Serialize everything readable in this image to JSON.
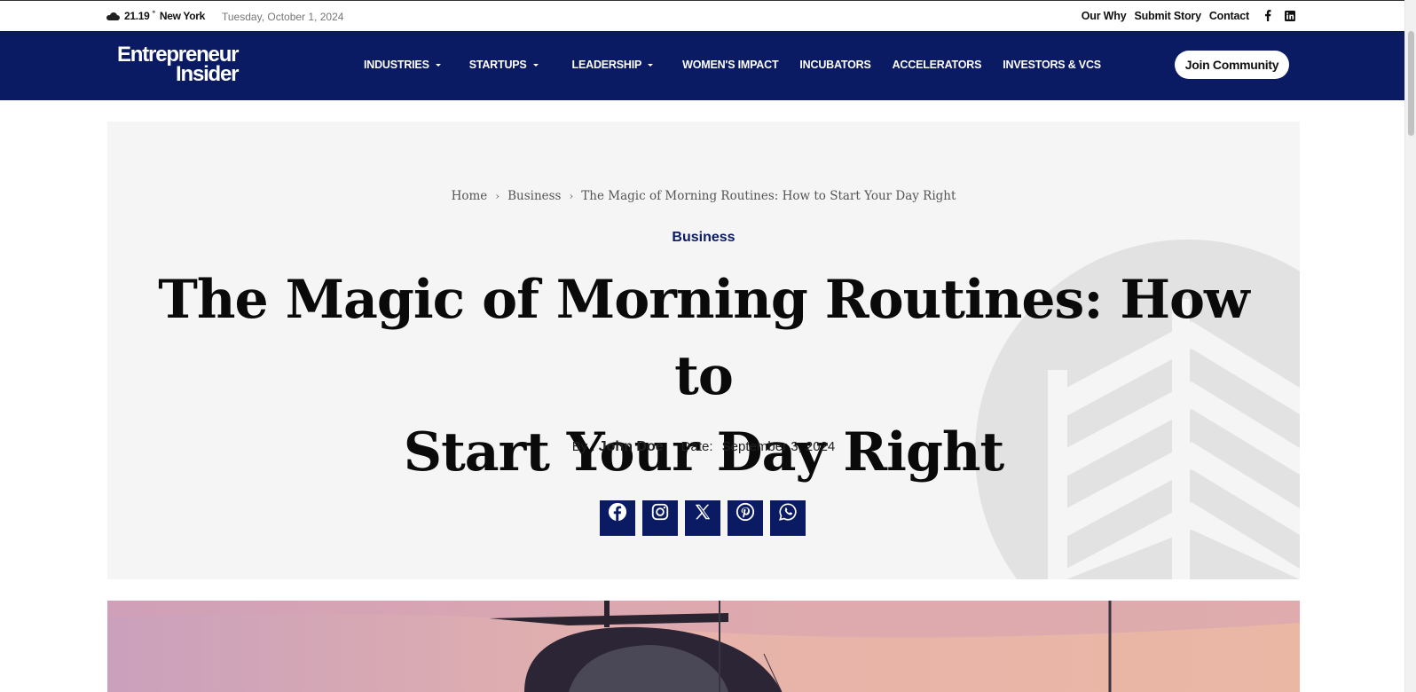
{
  "topbar": {
    "temperature": "21.19",
    "unit": "°",
    "city": "New York",
    "date": "Tuesday, October 1, 2024",
    "links": [
      "Our Why",
      "Submit Story",
      "Contact"
    ]
  },
  "nav": {
    "logo_line1": "Entrepreneur",
    "logo_line2": "Insider",
    "menu": [
      {
        "label": "INDUSTRIES",
        "dropdown": true
      },
      {
        "label": "STARTUPS",
        "dropdown": true
      },
      {
        "label": "LEADERSHIP",
        "dropdown": true
      },
      {
        "label": "WOMEN'S IMPACT",
        "dropdown": false
      },
      {
        "label": "INCUBATORS",
        "dropdown": false
      },
      {
        "label": "ACCELERATORS",
        "dropdown": false
      },
      {
        "label": "INVESTORS & VCS",
        "dropdown": false
      }
    ],
    "cta": "Join Community"
  },
  "article": {
    "breadcrumb": [
      "Home",
      "Business",
      "The Magic of Morning Routines: How to Start Your Day Right"
    ],
    "category": "Business",
    "title_line1": "The Magic of Morning Routines: How to",
    "title_line2": "Start Your Day Right",
    "by_label": "By :",
    "author": "John Doe",
    "date_label": "Date:",
    "date": "September 3, 2024",
    "share": [
      "facebook-icon",
      "instagram-icon",
      "x-icon",
      "pinterest-icon",
      "whatsapp-icon"
    ]
  },
  "colors": {
    "brand": "#0a1a63",
    "hero_bg": "#f5f5f5"
  }
}
